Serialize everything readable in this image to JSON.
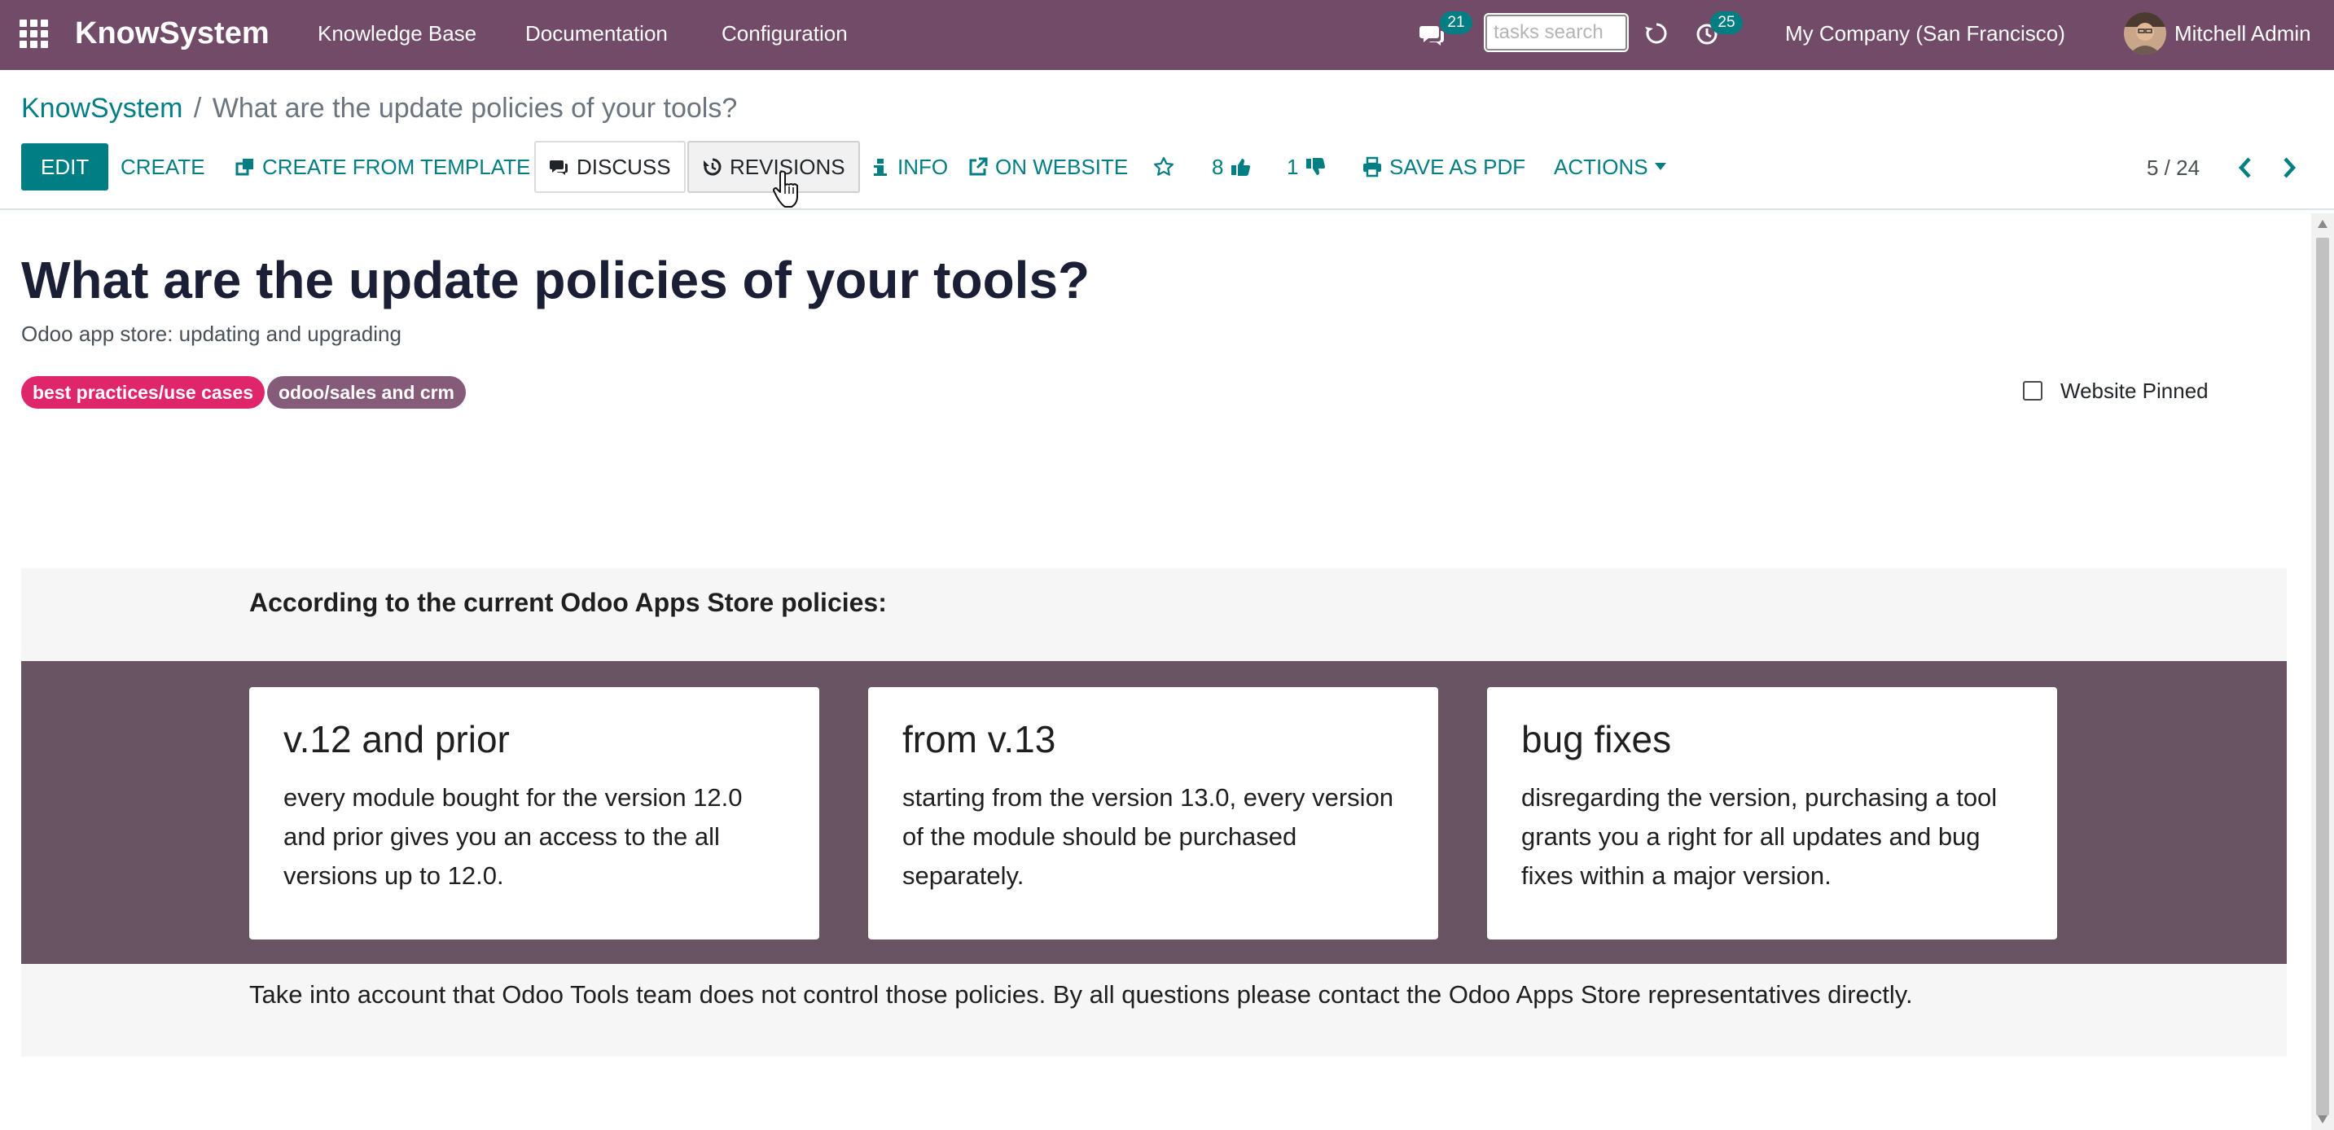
{
  "navbar": {
    "app_name": "KnowSystem",
    "menu": [
      "Knowledge Base",
      "Documentation",
      "Configuration"
    ],
    "messages_count": "21",
    "tasks_search_placeholder": "tasks search",
    "activities_count": "25",
    "company": "My Company (San Francisco)",
    "user": "Mitchell Admin",
    "bg_color": "#714B67",
    "badge_color": "#017E84"
  },
  "breadcrumb": {
    "parent": "KnowSystem",
    "separator": "/",
    "current": "What are the update policies of your tools?"
  },
  "toolbar": {
    "edit": "EDIT",
    "create": "CREATE",
    "create_from_template": "CREATE FROM TEMPLATE",
    "discuss": "DISCUSS",
    "revisions": "REVISIONS",
    "info": "INFO",
    "on_website": "ON WEBSITE",
    "likes": "8",
    "dislikes": "1",
    "save_as_pdf": "SAVE AS PDF",
    "actions": "ACTIONS",
    "accent_color": "#017E84"
  },
  "pager": {
    "value": "5 / 24"
  },
  "article": {
    "title": "What are the update policies of your tools?",
    "subtitle": "Odoo app store: updating and upgrading",
    "tags": [
      {
        "label": "best practices/use cases",
        "color": "#E0266B"
      },
      {
        "label": "odoo/sales and crm",
        "color": "#865A79"
      }
    ],
    "website_pinned_label": "Website Pinned",
    "website_pinned": false
  },
  "policies": {
    "intro": "According to the current Odoo Apps Store policies:",
    "band_color": "#695463",
    "cards": [
      {
        "title": "v.12 and prior",
        "text": "every module bought for the version 12.0 and prior gives you an access to the all versions up to 12.0."
      },
      {
        "title": "from v.13",
        "text": "starting from the version 13.0, every version of the module should be purchased separately."
      },
      {
        "title": "bug fixes",
        "text": "disregarding the version, purchasing a tool grants you a right for all updates and bug fixes within a major version."
      }
    ],
    "note": "Take into account that Odoo Tools team does not control those policies. By all questions please contact the Odoo Apps Store representatives directly."
  }
}
